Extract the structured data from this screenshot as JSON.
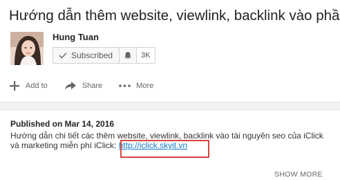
{
  "video": {
    "title": "Hướng dẫn thêm website, viewlink, backlink vào phần"
  },
  "channel": {
    "name": "Hung Tuan",
    "subscribe_label": "Subscribed",
    "subscriber_count": "3K"
  },
  "actions": {
    "add_to": "Add to",
    "share": "Share",
    "more": "More"
  },
  "description": {
    "published": "Published on Mar 14, 2016",
    "line1": "Hướng dẫn chi tiết các thêm website, viewlink, backlink vào tài nguyên seo của iClick",
    "line2_prefix": "và marketing miễn phí iClick: ",
    "link": "http://iclick.skyit.vn",
    "show_more": "SHOW MORE"
  },
  "colors": {
    "link": "#167ac6",
    "highlight": "#d2463f"
  },
  "icons": [
    "check-icon",
    "bell-icon",
    "plus-icon",
    "share-arrow-icon",
    "dots-icon"
  ]
}
